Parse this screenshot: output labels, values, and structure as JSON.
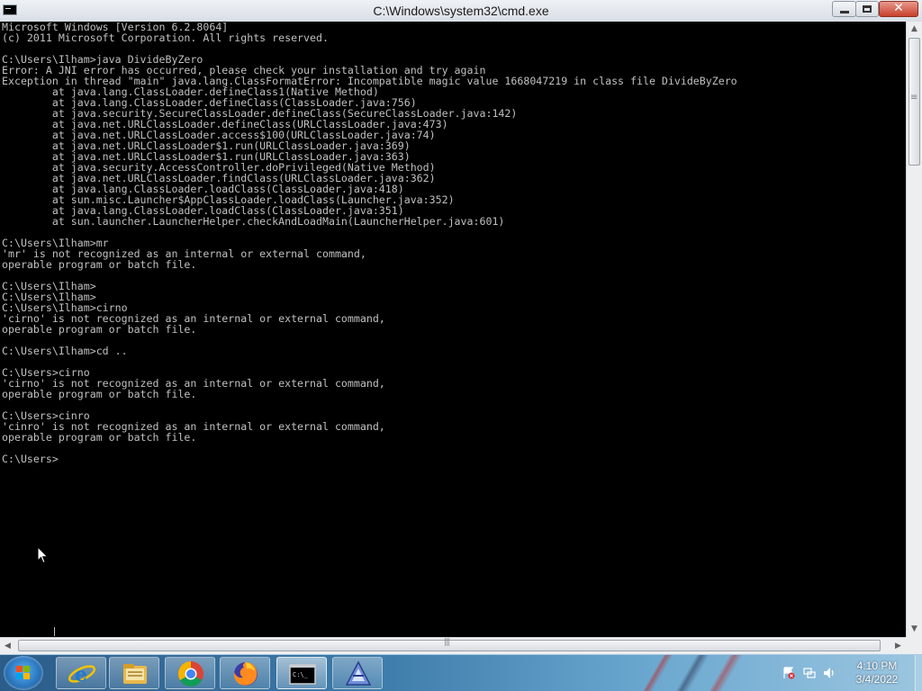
{
  "window": {
    "title": "C:\\Windows\\system32\\cmd.exe",
    "close_glyph": "✕"
  },
  "console": {
    "lines": [
      "Microsoft Windows [Version 6.2.8064]",
      "(c) 2011 Microsoft Corporation. All rights reserved.",
      "",
      "C:\\Users\\Ilham>java DivideByZero",
      "Error: A JNI error has occurred, please check your installation and try again",
      "Exception in thread \"main\" java.lang.ClassFormatError: Incompatible magic value 1668047219 in class file DivideByZero",
      "        at java.lang.ClassLoader.defineClass1(Native Method)",
      "        at java.lang.ClassLoader.defineClass(ClassLoader.java:756)",
      "        at java.security.SecureClassLoader.defineClass(SecureClassLoader.java:142)",
      "        at java.net.URLClassLoader.defineClass(URLClassLoader.java:473)",
      "        at java.net.URLClassLoader.access$100(URLClassLoader.java:74)",
      "        at java.net.URLClassLoader$1.run(URLClassLoader.java:369)",
      "        at java.net.URLClassLoader$1.run(URLClassLoader.java:363)",
      "        at java.security.AccessController.doPrivileged(Native Method)",
      "        at java.net.URLClassLoader.findClass(URLClassLoader.java:362)",
      "        at java.lang.ClassLoader.loadClass(ClassLoader.java:418)",
      "        at sun.misc.Launcher$AppClassLoader.loadClass(Launcher.java:352)",
      "        at java.lang.ClassLoader.loadClass(ClassLoader.java:351)",
      "        at sun.launcher.LauncherHelper.checkAndLoadMain(LauncherHelper.java:601)",
      "",
      "C:\\Users\\Ilham>mr",
      "'mr' is not recognized as an internal or external command,",
      "operable program or batch file.",
      "",
      "C:\\Users\\Ilham>",
      "C:\\Users\\Ilham>",
      "C:\\Users\\Ilham>cirno",
      "'cirno' is not recognized as an internal or external command,",
      "operable program or batch file.",
      "",
      "C:\\Users\\Ilham>cd ..",
      "",
      "C:\\Users>cirno",
      "'cirno' is not recognized as an internal or external command,",
      "operable program or batch file.",
      "",
      "C:\\Users>cinro",
      "'cinro' is not recognized as an internal or external command,",
      "operable program or batch file.",
      "",
      "C:\\Users>"
    ]
  },
  "taskbar": {
    "items": [
      {
        "name": "internet-explorer",
        "icon": "ie-icon"
      },
      {
        "name": "windows-explorer",
        "icon": "folder-icon"
      },
      {
        "name": "chrome",
        "icon": "chrome-icon"
      },
      {
        "name": "firefox",
        "icon": "firefox-icon"
      },
      {
        "name": "command-prompt",
        "icon": "cmd-icon",
        "active": true
      },
      {
        "name": "app",
        "icon": "app-icon"
      }
    ],
    "colors": {
      "console_bg": "#000000",
      "console_text": "#c0c0c0",
      "close_button": "#c8402c"
    }
  },
  "tray": {
    "time": "4:10 PM",
    "date": "3/4/2022",
    "icons": [
      "action-center-icon",
      "network-icon",
      "volume-icon"
    ]
  }
}
